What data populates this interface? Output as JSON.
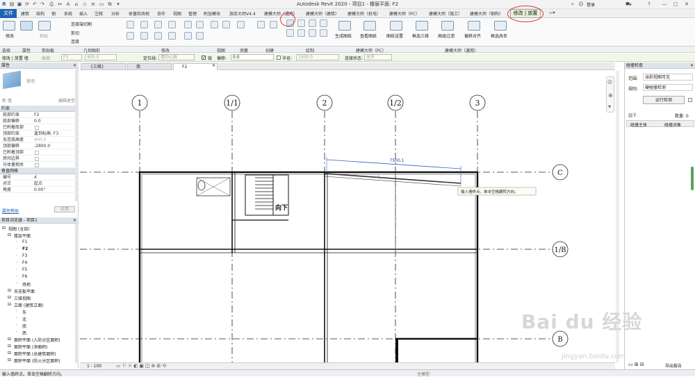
{
  "app": {
    "title": "Autodesk Revit 2020 - 项目1 - 楼层平面: F2",
    "login": "登录"
  },
  "tabs": [
    "文件",
    "建筑",
    "结构",
    "钢",
    "系统",
    "插入",
    "注释",
    "分析",
    "体量和场地",
    "协作",
    "视图",
    "管理",
    "附加模块",
    "族库大师V4.4",
    "建模大师（通用）",
    "建模大师（建筑）",
    "建模大师（机电）",
    "建模大师（PC）",
    "建模大师（施工）",
    "建模大师（钢构）",
    "修改 | 放置 墙"
  ],
  "ribbon": {
    "modify_label": "修改",
    "paste_label": "粘贴",
    "join_label": "连接端切割",
    "cut_label": "剪切",
    "connect_label": "连接",
    "panels": [
      "选择",
      "属性",
      "剪贴板",
      "几何图形",
      "修改",
      "视图",
      "测量",
      "创建",
      "绘制",
      "建模大师（PC）",
      "建模大师（通用）"
    ],
    "pc_buttons": [
      "生成图纸",
      "查看图纸",
      "图纸设置"
    ],
    "general_buttons": [
      "框选三维",
      "高级过滤",
      "偏移对齐",
      "框选改名"
    ]
  },
  "optionbar": {
    "context": "修改 | 放置 墙",
    "height_label": "高度:",
    "height_value": "F3",
    "height_number": "400.0",
    "locline_label": "定位线:",
    "locline_value": "墙中心线",
    "chain_label": "链",
    "offset_label": "偏移:",
    "offset_value": "0.0",
    "radius_label": "半径:",
    "radius_value": "1000.0",
    "join_label": "连接状态:",
    "join_value": "允许"
  },
  "properties": {
    "header": "属性",
    "type_name": "基墙",
    "new_label": "新 墙",
    "edit_type": "编辑类型",
    "group_constraints": "约束",
    "rows": [
      {
        "k": "底部约束",
        "v": "F2"
      },
      {
        "k": "底部偏移",
        "v": "0.0"
      },
      {
        "k": "已附着底部",
        "v": ""
      },
      {
        "k": "顶部约束",
        "v": "直到标高: F3"
      },
      {
        "k": "无连接高度",
        "v": "400.0"
      },
      {
        "k": "顶部偏移",
        "v": "-2800.0"
      },
      {
        "k": "已附着顶部",
        "v": ""
      },
      {
        "k": "房间边界",
        "v": ""
      },
      {
        "k": "与体量相关",
        "v": ""
      }
    ],
    "group_grid": "垂直网格",
    "grid_rows": [
      {
        "k": "编号",
        "v": "4"
      },
      {
        "k": "对正",
        "v": "起点"
      },
      {
        "k": "角度",
        "v": "0.00°"
      }
    ],
    "help_link": "属性帮助",
    "apply": "应用"
  },
  "browser": {
    "header": "项目浏览器 - 项目1",
    "items": [
      {
        "label": "视图 (全部)",
        "level": 0
      },
      {
        "label": "楼层平面",
        "level": 1
      },
      {
        "label": "F1",
        "level": 2
      },
      {
        "label": "F2",
        "level": 2
      },
      {
        "label": "F3",
        "level": 2
      },
      {
        "label": "F4",
        "level": 2
      },
      {
        "label": "F5",
        "level": 2
      },
      {
        "label": "F6",
        "level": 2
      },
      {
        "label": "场地",
        "level": 2
      },
      {
        "label": "天花板平面",
        "level": 1
      },
      {
        "label": "三维视图",
        "level": 1
      },
      {
        "label": "立面 (建筑立面)",
        "level": 1
      },
      {
        "label": "东",
        "level": 2
      },
      {
        "label": "北",
        "level": 2
      },
      {
        "label": "南",
        "level": 2
      },
      {
        "label": "西",
        "level": 2
      },
      {
        "label": "面积平面 (人防分区面积)",
        "level": 1
      },
      {
        "label": "面积平面 (净面积)",
        "level": 1
      },
      {
        "label": "面积平面 (总建筑面积)",
        "level": 1
      },
      {
        "label": "面积平面 (防火分区面积)",
        "level": 1
      }
    ]
  },
  "viewtabs": [
    "{三维}",
    "南",
    "F2"
  ],
  "drawing": {
    "grids_v": [
      "1",
      "1/1",
      "2",
      "1/2",
      "3"
    ],
    "grids_h": [
      "C",
      "1/B",
      "B"
    ],
    "dimension": "7500.1",
    "stair_label": "向下",
    "tooltip": "输入墙终点。单击空格翻转方向。"
  },
  "view_status": {
    "scale": "1 : 100"
  },
  "clash": {
    "header": "碰撞检查",
    "range_label": "范围:",
    "range_value": "当前视图可见",
    "rule_label": "规则:",
    "rule_value": "硬碰撞检测",
    "run_button": "运行检测",
    "count_label": "数量: 0",
    "col1": "碰撞主体",
    "col2": "碰撞对象",
    "export": "导出报告"
  },
  "statusbar": {
    "message": "输入墙终点。单击空格翻转方向。",
    "model": "主模型"
  },
  "watermark": {
    "main": "Bai du 经验",
    "sub": "jingyan.baidu.com"
  }
}
